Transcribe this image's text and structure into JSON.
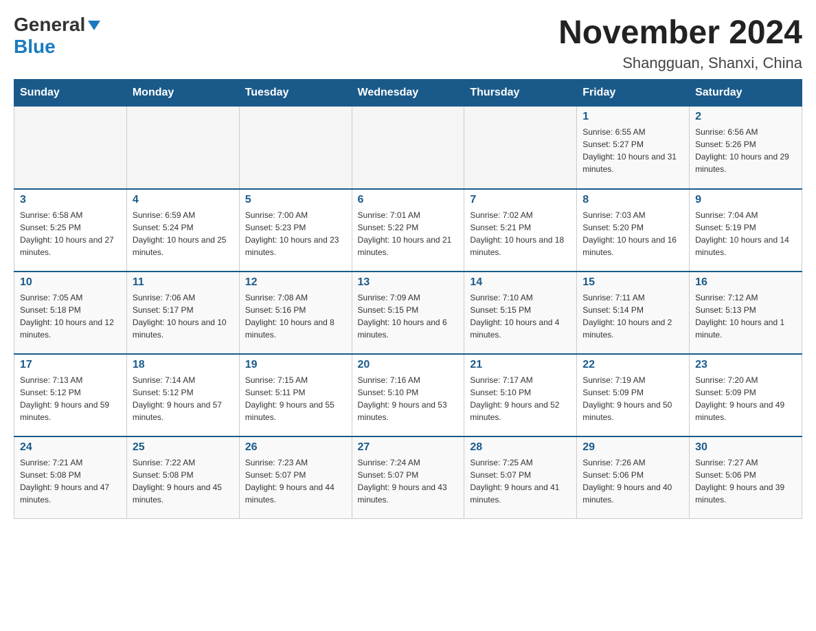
{
  "logo": {
    "text1": "General",
    "text2": "Blue"
  },
  "title": "November 2024",
  "subtitle": "Shangguan, Shanxi, China",
  "weekdays": [
    "Sunday",
    "Monday",
    "Tuesday",
    "Wednesday",
    "Thursday",
    "Friday",
    "Saturday"
  ],
  "weeks": [
    [
      {
        "day": "",
        "info": ""
      },
      {
        "day": "",
        "info": ""
      },
      {
        "day": "",
        "info": ""
      },
      {
        "day": "",
        "info": ""
      },
      {
        "day": "",
        "info": ""
      },
      {
        "day": "1",
        "info": "Sunrise: 6:55 AM\nSunset: 5:27 PM\nDaylight: 10 hours and 31 minutes."
      },
      {
        "day": "2",
        "info": "Sunrise: 6:56 AM\nSunset: 5:26 PM\nDaylight: 10 hours and 29 minutes."
      }
    ],
    [
      {
        "day": "3",
        "info": "Sunrise: 6:58 AM\nSunset: 5:25 PM\nDaylight: 10 hours and 27 minutes."
      },
      {
        "day": "4",
        "info": "Sunrise: 6:59 AM\nSunset: 5:24 PM\nDaylight: 10 hours and 25 minutes."
      },
      {
        "day": "5",
        "info": "Sunrise: 7:00 AM\nSunset: 5:23 PM\nDaylight: 10 hours and 23 minutes."
      },
      {
        "day": "6",
        "info": "Sunrise: 7:01 AM\nSunset: 5:22 PM\nDaylight: 10 hours and 21 minutes."
      },
      {
        "day": "7",
        "info": "Sunrise: 7:02 AM\nSunset: 5:21 PM\nDaylight: 10 hours and 18 minutes."
      },
      {
        "day": "8",
        "info": "Sunrise: 7:03 AM\nSunset: 5:20 PM\nDaylight: 10 hours and 16 minutes."
      },
      {
        "day": "9",
        "info": "Sunrise: 7:04 AM\nSunset: 5:19 PM\nDaylight: 10 hours and 14 minutes."
      }
    ],
    [
      {
        "day": "10",
        "info": "Sunrise: 7:05 AM\nSunset: 5:18 PM\nDaylight: 10 hours and 12 minutes."
      },
      {
        "day": "11",
        "info": "Sunrise: 7:06 AM\nSunset: 5:17 PM\nDaylight: 10 hours and 10 minutes."
      },
      {
        "day": "12",
        "info": "Sunrise: 7:08 AM\nSunset: 5:16 PM\nDaylight: 10 hours and 8 minutes."
      },
      {
        "day": "13",
        "info": "Sunrise: 7:09 AM\nSunset: 5:15 PM\nDaylight: 10 hours and 6 minutes."
      },
      {
        "day": "14",
        "info": "Sunrise: 7:10 AM\nSunset: 5:15 PM\nDaylight: 10 hours and 4 minutes."
      },
      {
        "day": "15",
        "info": "Sunrise: 7:11 AM\nSunset: 5:14 PM\nDaylight: 10 hours and 2 minutes."
      },
      {
        "day": "16",
        "info": "Sunrise: 7:12 AM\nSunset: 5:13 PM\nDaylight: 10 hours and 1 minute."
      }
    ],
    [
      {
        "day": "17",
        "info": "Sunrise: 7:13 AM\nSunset: 5:12 PM\nDaylight: 9 hours and 59 minutes."
      },
      {
        "day": "18",
        "info": "Sunrise: 7:14 AM\nSunset: 5:12 PM\nDaylight: 9 hours and 57 minutes."
      },
      {
        "day": "19",
        "info": "Sunrise: 7:15 AM\nSunset: 5:11 PM\nDaylight: 9 hours and 55 minutes."
      },
      {
        "day": "20",
        "info": "Sunrise: 7:16 AM\nSunset: 5:10 PM\nDaylight: 9 hours and 53 minutes."
      },
      {
        "day": "21",
        "info": "Sunrise: 7:17 AM\nSunset: 5:10 PM\nDaylight: 9 hours and 52 minutes."
      },
      {
        "day": "22",
        "info": "Sunrise: 7:19 AM\nSunset: 5:09 PM\nDaylight: 9 hours and 50 minutes."
      },
      {
        "day": "23",
        "info": "Sunrise: 7:20 AM\nSunset: 5:09 PM\nDaylight: 9 hours and 49 minutes."
      }
    ],
    [
      {
        "day": "24",
        "info": "Sunrise: 7:21 AM\nSunset: 5:08 PM\nDaylight: 9 hours and 47 minutes."
      },
      {
        "day": "25",
        "info": "Sunrise: 7:22 AM\nSunset: 5:08 PM\nDaylight: 9 hours and 45 minutes."
      },
      {
        "day": "26",
        "info": "Sunrise: 7:23 AM\nSunset: 5:07 PM\nDaylight: 9 hours and 44 minutes."
      },
      {
        "day": "27",
        "info": "Sunrise: 7:24 AM\nSunset: 5:07 PM\nDaylight: 9 hours and 43 minutes."
      },
      {
        "day": "28",
        "info": "Sunrise: 7:25 AM\nSunset: 5:07 PM\nDaylight: 9 hours and 41 minutes."
      },
      {
        "day": "29",
        "info": "Sunrise: 7:26 AM\nSunset: 5:06 PM\nDaylight: 9 hours and 40 minutes."
      },
      {
        "day": "30",
        "info": "Sunrise: 7:27 AM\nSunset: 5:06 PM\nDaylight: 9 hours and 39 minutes."
      }
    ]
  ]
}
